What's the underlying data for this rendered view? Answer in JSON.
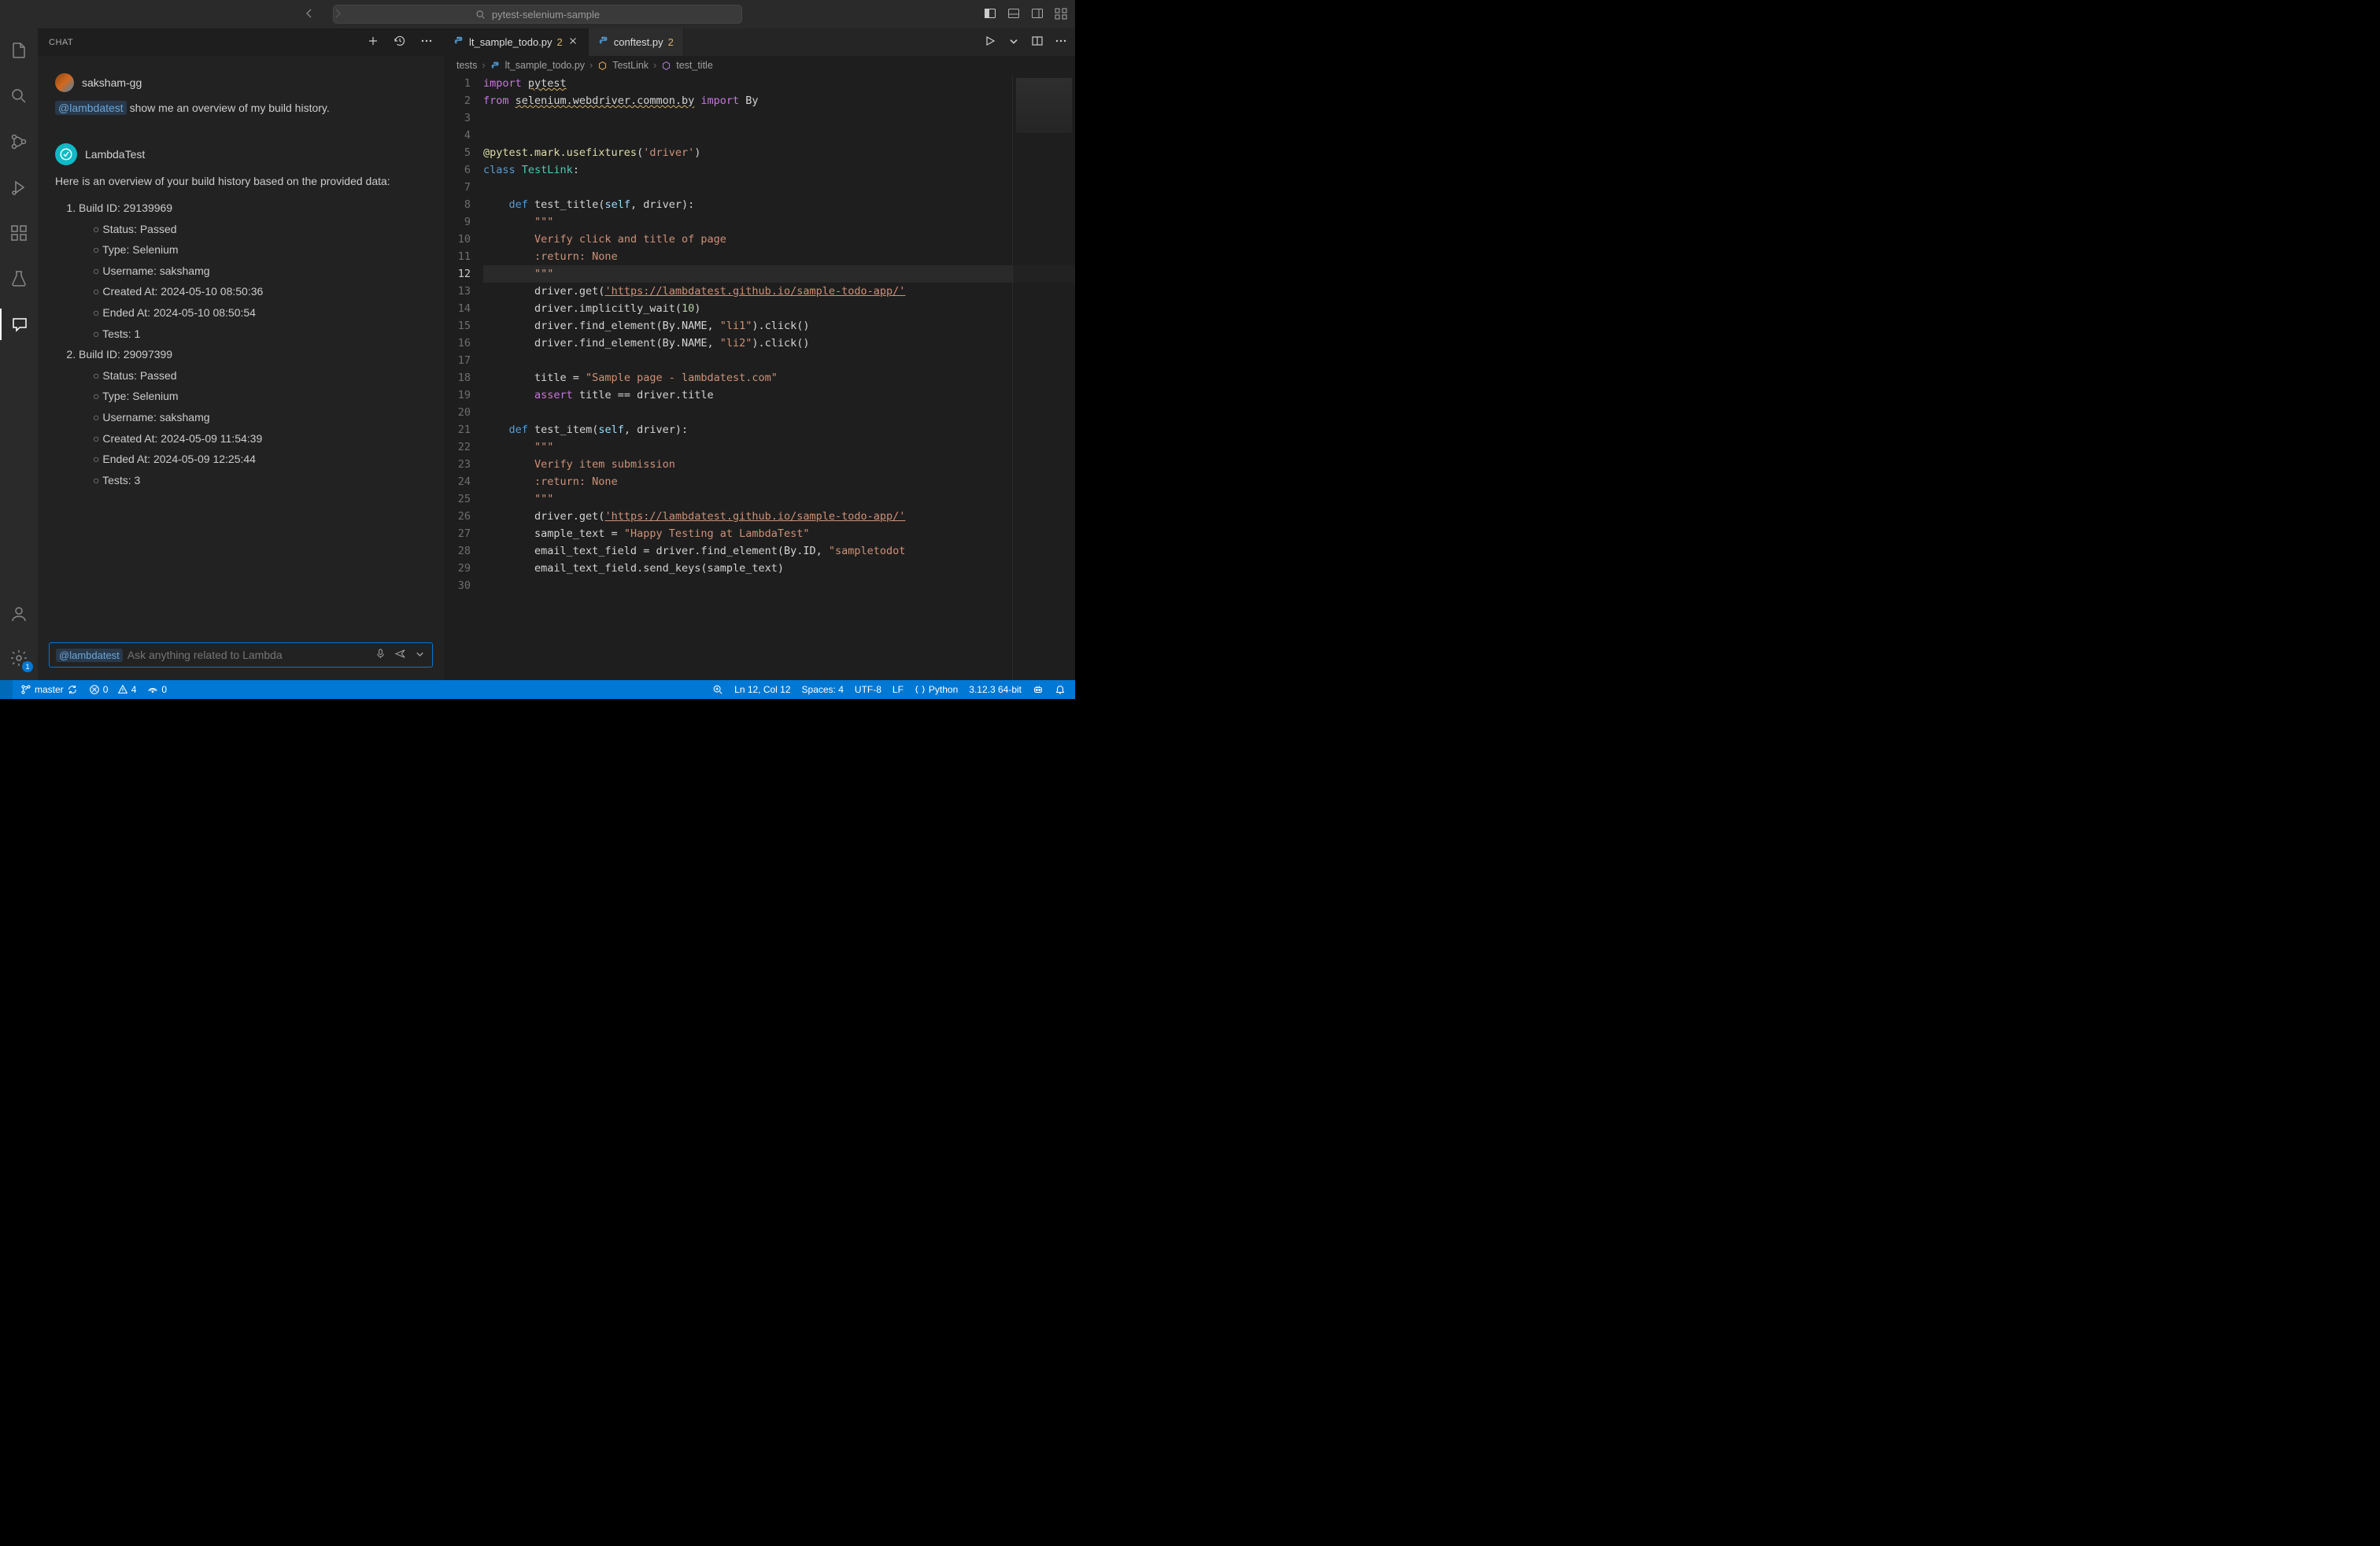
{
  "titlebar": {
    "search": "pytest-selenium-sample"
  },
  "sidebar": {
    "title": "CHAT",
    "update_badge": "1"
  },
  "chat": {
    "user": {
      "name": "saksham-gg",
      "mention": "@lambdatest",
      "message": "show me an overview of my build history."
    },
    "bot": {
      "name": "LambdaTest",
      "intro": "Here is an overview of your build history based on the provided data:",
      "builds": [
        {
          "label": "Build ID: 29139969",
          "details": [
            "Status: Passed",
            "Type: Selenium",
            "Username: sakshamg",
            "Created At: 2024-05-10 08:50:36",
            "Ended At: 2024-05-10 08:50:54",
            "Tests: 1"
          ]
        },
        {
          "label": "Build ID: 29097399",
          "details": [
            "Status: Passed",
            "Type: Selenium",
            "Username: sakshamg",
            "Created At: 2024-05-09 11:54:39",
            "Ended At: 2024-05-09 12:25:44",
            "Tests: 3"
          ]
        }
      ]
    },
    "input": {
      "mention": "@lambdatest",
      "placeholder": "Ask anything related to Lambda"
    }
  },
  "tabs": [
    {
      "name": "lt_sample_todo.py",
      "mod": "2",
      "active": true,
      "close": true
    },
    {
      "name": "conftest.py",
      "mod": "2",
      "active": false,
      "close": false
    }
  ],
  "breadcrumb": {
    "seg0": "tests",
    "seg1": "lt_sample_todo.py",
    "seg2": "TestLink",
    "seg3": "test_title"
  },
  "code": {
    "lines": 30,
    "active_line": 12
  },
  "statusbar": {
    "branch": "master",
    "errors": "0",
    "warnings": "4",
    "ports": "0",
    "cursor": "Ln 12, Col 12",
    "spaces": "Spaces: 4",
    "encoding": "UTF-8",
    "eol": "LF",
    "lang": "Python",
    "interp": "3.12.3 64-bit"
  }
}
